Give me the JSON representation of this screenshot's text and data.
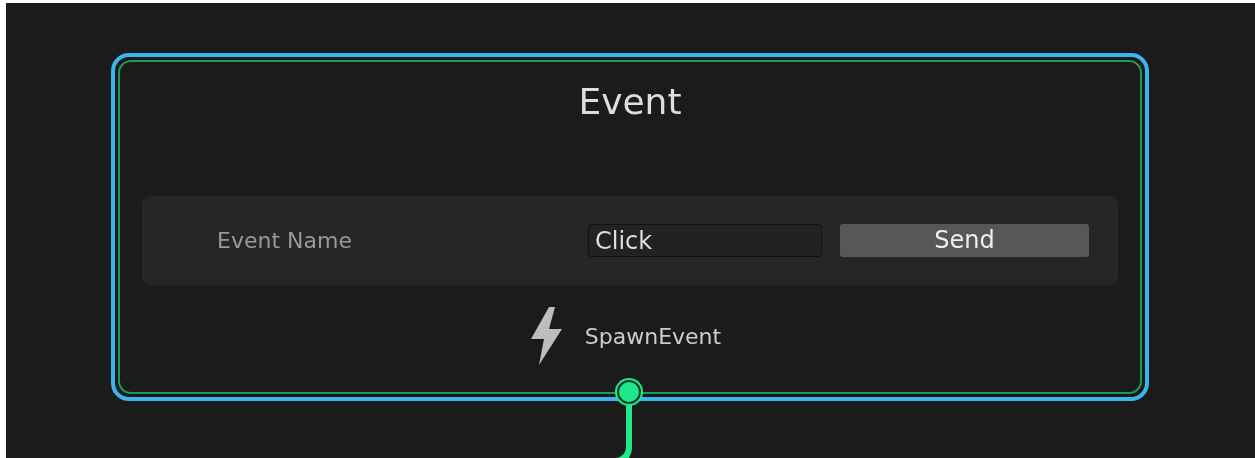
{
  "node": {
    "title": "Event",
    "selected": true,
    "fields": [
      {
        "label": "Event Name",
        "value": "Click",
        "button": "Send"
      }
    ],
    "output": {
      "label": "SpawnEvent",
      "connected": true
    }
  }
}
